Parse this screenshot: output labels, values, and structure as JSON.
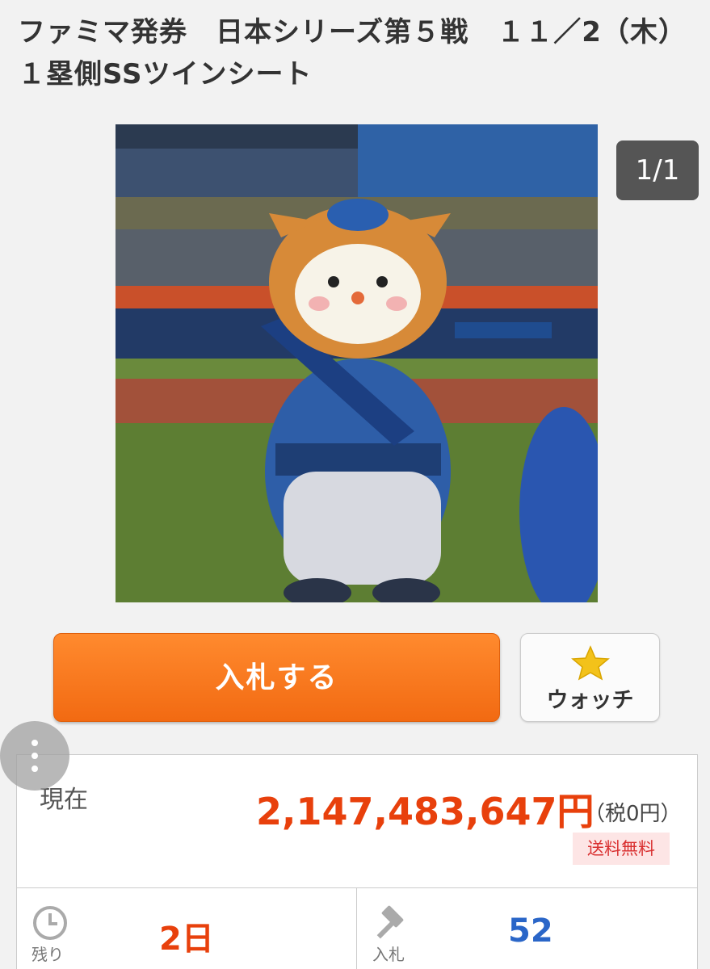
{
  "listing": {
    "title": "ファミマ発券　日本シリーズ第５戦　１１／2（木）１塁側SSツインシート",
    "image_counter": "1/1",
    "image_alt": "Baseball mascot in Yokohama uniform on field"
  },
  "actions": {
    "bid_label": "入札する",
    "watch_label": "ウォッチ",
    "watch_icon": "star-icon",
    "menu_icon": "vertical-dots-icon"
  },
  "price": {
    "label": "現在",
    "value": "2,147,483,647円",
    "tax": "（税0円）",
    "shipping": "送料無料"
  },
  "stats": {
    "remaining_label": "残り",
    "remaining_value": "2日",
    "remaining_icon": "clock-icon",
    "bids_label": "入札",
    "bids_value": "52",
    "bids_icon": "gavel-icon"
  },
  "colors": {
    "bid_button": "#f26a12",
    "price": "#e8400c",
    "bids_count": "#2a66c8",
    "shipping_badge_bg": "#fde5e5"
  }
}
